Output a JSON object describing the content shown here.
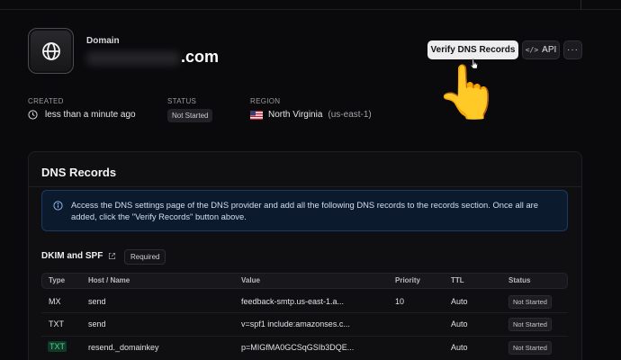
{
  "header": {
    "domain_label": "Domain",
    "domain_suffix": ".com",
    "domain_icon": "globe-icon",
    "verify_label": "Verify DNS Records",
    "api_label": "API",
    "api_icon": "code-icon",
    "more_label": "···"
  },
  "meta": {
    "created_label": "CREATED",
    "created_value": "less than a minute ago",
    "status_label": "STATUS",
    "status_value": "Not Started",
    "region_label": "REGION",
    "region_name": "North Virginia",
    "region_code": "(us-east-1)"
  },
  "dns": {
    "title": "DNS Records",
    "info_text": "Access the DNS settings page of the DNS provider and add all the following DNS records to the records section. Once all are added, click the \"Verify Records\" button above.",
    "section_title": "DKIM and SPF",
    "required_label": "Required",
    "columns": [
      "Type",
      "Host / Name",
      "Value",
      "Priority",
      "TTL",
      "Status"
    ],
    "rows": [
      {
        "type": "MX",
        "host": "send",
        "value": "feedback-smtp.us-east-1.a...",
        "priority": "10",
        "ttl": "Auto",
        "status": "Not Started"
      },
      {
        "type": "TXT",
        "host": "send",
        "value": "v=spf1 include:amazonses.c...",
        "priority": "",
        "ttl": "Auto",
        "status": "Not Started"
      },
      {
        "type": "TXT",
        "host": "resend._domainkey",
        "value": "p=MIGfMA0GCSqGSIb3DQE...",
        "priority": "",
        "ttl": "Auto",
        "status": "Not Started"
      }
    ]
  },
  "colors": {
    "background": "#0a0a0c",
    "info_bg": "#0c1a2e",
    "info_border": "#1a3a66",
    "highlight_green": "#54d08f"
  }
}
